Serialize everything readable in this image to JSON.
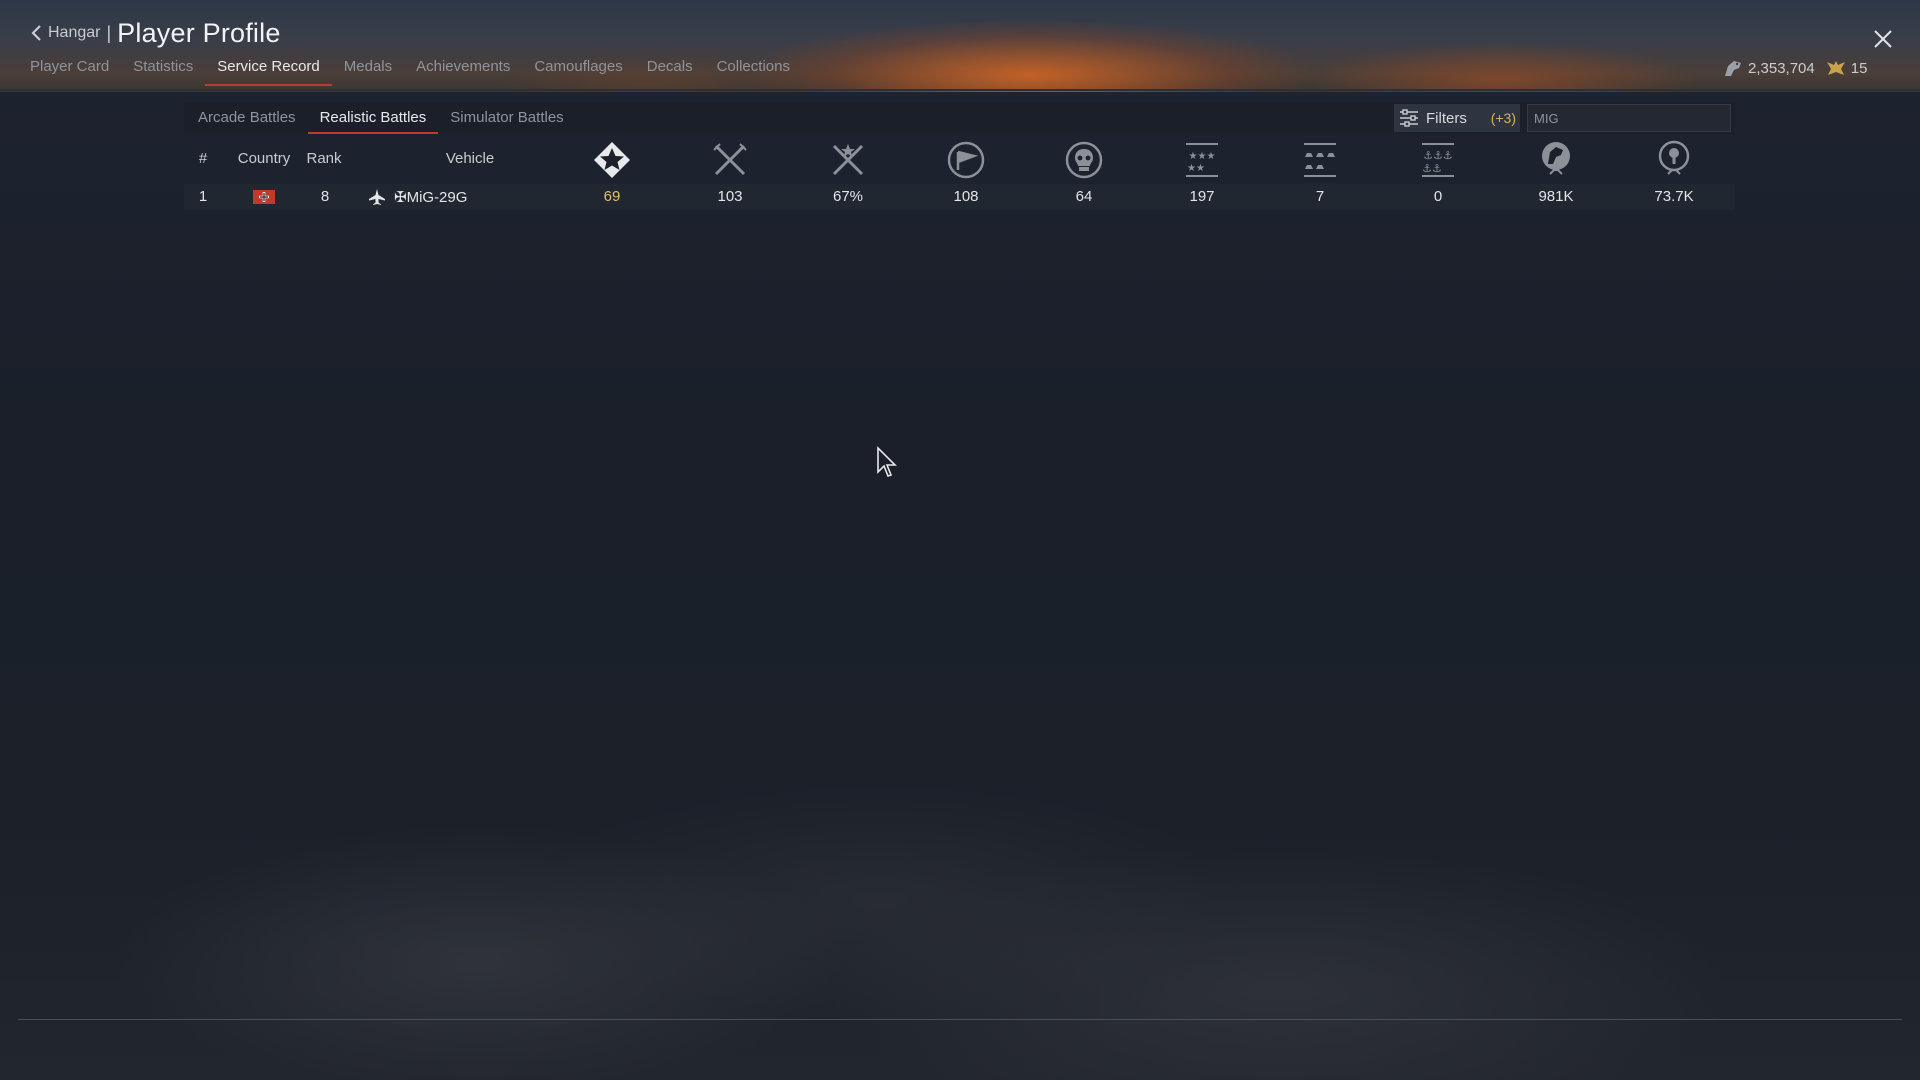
{
  "header": {
    "back_label": "Hangar",
    "separator": "|",
    "title": "Player Profile"
  },
  "tabs": [
    {
      "label": "Player Card"
    },
    {
      "label": "Statistics"
    },
    {
      "label": "Service Record",
      "active": true
    },
    {
      "label": "Medals"
    },
    {
      "label": "Achievements"
    },
    {
      "label": "Camouflages"
    },
    {
      "label": "Decals"
    },
    {
      "label": "Collections"
    }
  ],
  "currency": {
    "silver_lions": "2,353,704",
    "golden_eagles": "15"
  },
  "subtabs": [
    {
      "label": "Arcade Battles"
    },
    {
      "label": "Realistic Battles",
      "active": true
    },
    {
      "label": "Simulator Battles"
    }
  ],
  "filters": {
    "label": "Filters",
    "count": "(+3)",
    "search_value": "MIG",
    "search_placeholder": "MIG"
  },
  "table": {
    "headers": {
      "index": "#",
      "country": "Country",
      "rank": "Rank",
      "vehicle": "Vehicle"
    },
    "stat_icons": [
      "victories-icon",
      "missions-icon",
      "win-rate-icon",
      "respawns-icon",
      "deaths-icon",
      "air-kills-icon",
      "ground-kills-icon",
      "naval-kills-icon",
      "silver-lions-icon",
      "research-points-icon"
    ],
    "rows": [
      {
        "index": "1",
        "country": "Germany",
        "rank": "8",
        "vehicle": "✠MiG-29G",
        "victories": "69",
        "missions": "103",
        "win_rate": "67%",
        "respawns": "108",
        "deaths": "64",
        "air_kills": "197",
        "ground_kills": "7",
        "naval_kills": "0",
        "silver_lions": "981K",
        "research_points": "73.7K"
      }
    ]
  },
  "colors": {
    "accent_red": "#c0392b",
    "highlight_gold": "#e4c06c",
    "background": "#1b2029"
  }
}
